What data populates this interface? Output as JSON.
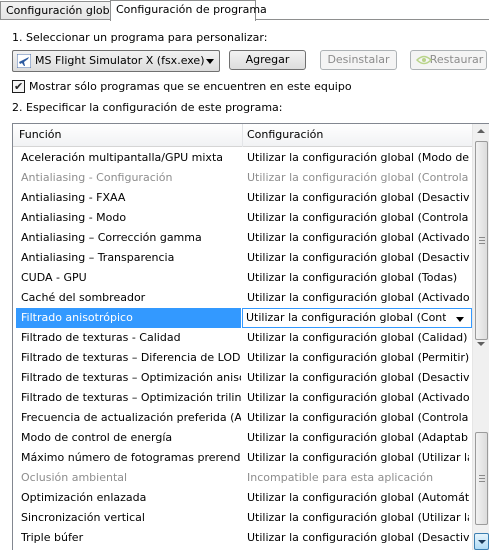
{
  "tabs": [
    {
      "label": "Configuración global"
    },
    {
      "label": "Configuración de programa"
    }
  ],
  "step1": {
    "label": "1. Seleccionar un programa para personalizar:"
  },
  "program_select": {
    "value": "MS Flight Simulator X (fsx.exe)"
  },
  "buttons": {
    "add": "Agregar",
    "uninstall": "Desinstalar",
    "restore": "Restaurar"
  },
  "show_only_installed": {
    "label": "Mostrar sólo programas que se encuentren en este equipo",
    "checked": true
  },
  "step2": {
    "label": "2. Especificar la configuración de este programa:"
  },
  "table": {
    "headers": {
      "function": "Función",
      "setting": "Configuración"
    },
    "rows": [
      {
        "function": "Aceleración multipantalla/GPU mixta",
        "setting": "Utilizar la configuración global (Modo de re..."
      },
      {
        "function": "Antialiasing - Configuración",
        "setting": "Utilizar la configuración global (Controlado ..."
      },
      {
        "function": "Antialiasing - FXAA",
        "setting": "Utilizar la configuración global (Desactivado)"
      },
      {
        "function": "Antialiasing - Modo",
        "setting": "Utilizar la configuración global (Controlado ..."
      },
      {
        "function": "Antialiasing – Corrección gamma",
        "setting": "Utilizar la configuración global (Activado)"
      },
      {
        "function": "Antialiasing – Transparencia",
        "setting": "Utilizar la configuración global (Desactivado)"
      },
      {
        "function": "CUDA - GPU",
        "setting": "Utilizar la configuración global (Todas)"
      },
      {
        "function": "Caché del sombreador",
        "setting": "Utilizar la configuración global (Activado)"
      },
      {
        "function": "Filtrado anisotrópico",
        "setting": "Utilizar la configuración global (Controlado"
      },
      {
        "function": "Filtrado de texturas - Calidad",
        "setting": "Utilizar la configuración global (Calidad)"
      },
      {
        "function": "Filtrado de texturas – Diferencia de LOD n...",
        "setting": "Utilizar la configuración global (Permitir)"
      },
      {
        "function": "Filtrado de texturas – Optimización anisotr...",
        "setting": "Utilizar la configuración global (Desactivado)"
      },
      {
        "function": "Filtrado de texturas – Optimización trilineal",
        "setting": "Utilizar la configuración global (Activado)"
      },
      {
        "function": "Frecuencia de actualización preferida (Anc...",
        "setting": "Utilizar la configuración global (Controlado ..."
      },
      {
        "function": "Modo de control de energía",
        "setting": "Utilizar la configuración global (Adaptable)"
      },
      {
        "function": "Máximo número de fotogramas prerenderi...",
        "setting": "Utilizar la configuración global (Utilizar la c..."
      },
      {
        "function": "Oclusión ambiental",
        "setting": "Incompatible para esta aplicación"
      },
      {
        "function": "Optimización enlazada",
        "setting": "Utilizar la configuración global (Automático)"
      },
      {
        "function": "Sincronización vertical",
        "setting": "Utilizar la configuración global (Utilizar la c..."
      },
      {
        "function": "Triple búfer",
        "setting": "Utilizar la configuración global (Desactivado)"
      }
    ]
  },
  "colors": {
    "selection": "#3399ff",
    "disabled_text": "#8d8d8d",
    "nvidia_green": "#76b900"
  },
  "icons": {
    "program": "airplane-icon",
    "restore": "nvidia-logo-icon",
    "dropdown": "chevron-down-icon"
  }
}
